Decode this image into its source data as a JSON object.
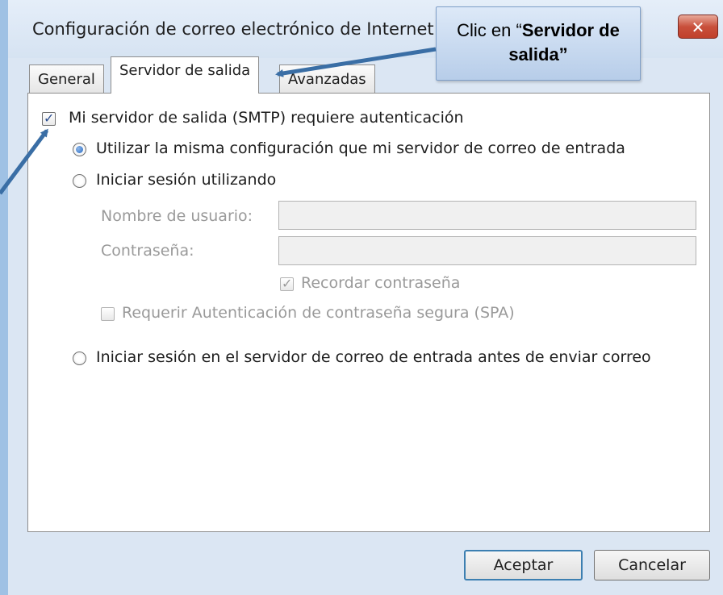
{
  "window": {
    "title": "Configuración de correo electrónico de Internet",
    "close_label": "✕"
  },
  "callout": {
    "prefix": "Clic en “",
    "bold": "Servidor de salida”"
  },
  "tabs": [
    {
      "label": "General",
      "active": false
    },
    {
      "label": "Servidor de salida",
      "active": true
    },
    {
      "label": "Avanzadas",
      "active": false
    }
  ],
  "auth": {
    "requires_auth_label": "Mi servidor de salida (SMTP) requiere autenticación",
    "requires_auth_checked": true,
    "options": [
      {
        "label": "Utilizar la misma configuración que mi servidor de correo de entrada",
        "selected": true
      },
      {
        "label": "Iniciar sesión utilizando",
        "selected": false
      },
      {
        "label": "Iniciar sesión en el servidor de correo de entrada antes de enviar correo",
        "selected": false
      }
    ],
    "username_label": "Nombre de usuario:",
    "username_value": "",
    "password_label": "Contraseña:",
    "password_value": "",
    "remember_password_label": "Recordar contraseña",
    "remember_password_checked": true,
    "spa_label": "Requerir Autenticación de contraseña segura (SPA)",
    "spa_checked": false
  },
  "buttons": {
    "ok": "Aceptar",
    "cancel": "Cancelar"
  },
  "colors": {
    "arrow": "#3a6ea5",
    "frame": "#dbe6f3"
  }
}
